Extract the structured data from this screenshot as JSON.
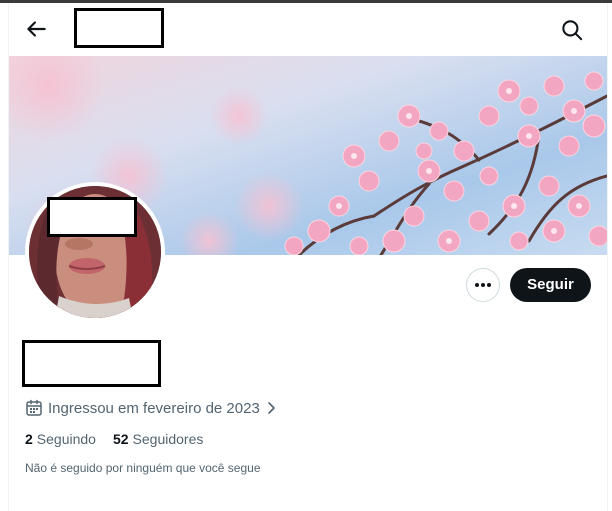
{
  "header": {
    "back_icon": "arrow-left-icon",
    "search_icon": "search-icon"
  },
  "profile": {
    "banner": "cherry-blossom-banner",
    "follow_label": "Seguir",
    "more_icon": "more-horizontal-icon",
    "joined_text": "Ingressou em fevereiro de 2023",
    "following_count": "2",
    "following_label": "Seguindo",
    "followers_count": "52",
    "followers_label": "Seguidores",
    "followed_by_note": "Não é seguido por ninguém que você segue"
  },
  "colors": {
    "text_primary": "#0f1419",
    "text_secondary": "#536471",
    "follow_button_bg": "#0f1419",
    "border": "#cfd9de",
    "sky": "#b9d3ef",
    "blossom": "#f2a7c0"
  }
}
